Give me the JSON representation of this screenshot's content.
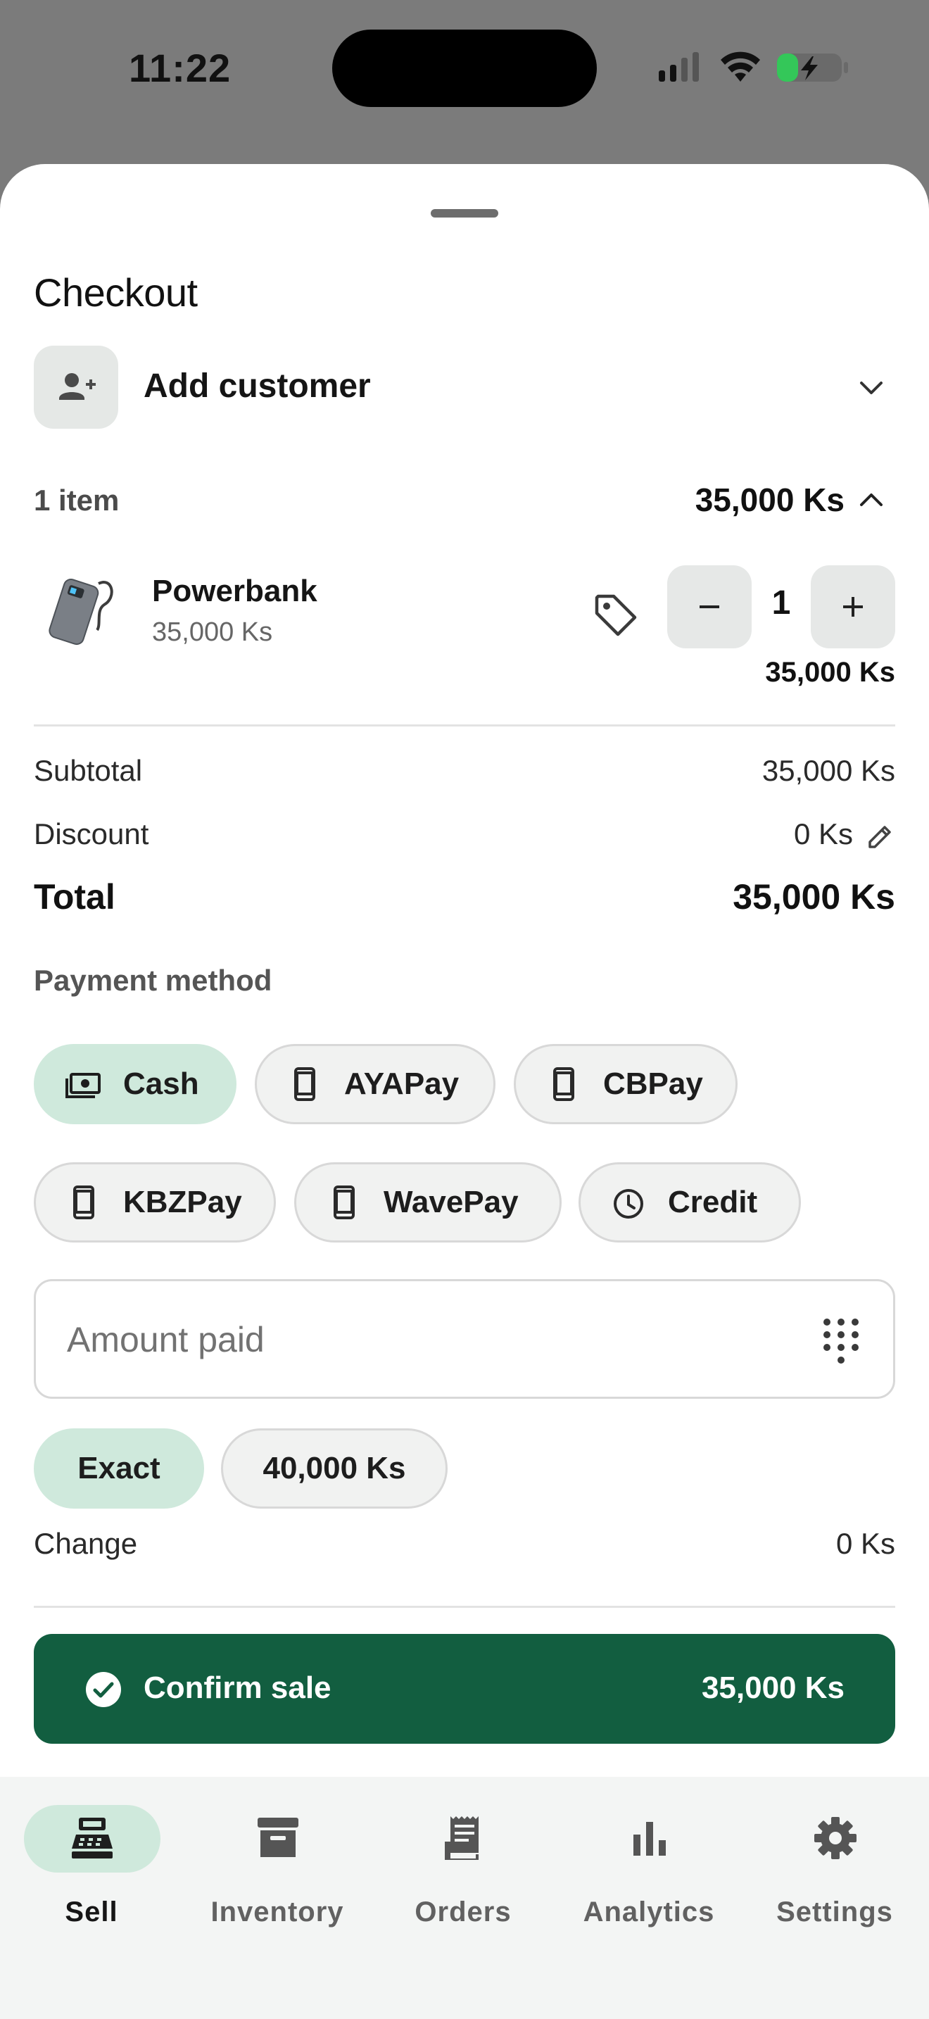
{
  "status_bar": {
    "time": "11:22"
  },
  "checkout": {
    "title": "Checkout",
    "customer": {
      "label": "Add customer"
    },
    "items": {
      "count_label": "1 item",
      "total": "35,000 Ks"
    },
    "products": [
      {
        "name": "Powerbank",
        "unit_price": "35,000 Ks",
        "quantity": "1",
        "line_total": "35,000 Ks"
      }
    ],
    "summary": {
      "subtotal_label": "Subtotal",
      "subtotal_value": "35,000 Ks",
      "discount_label": "Discount",
      "discount_value": "0 Ks",
      "total_label": "Total",
      "total_value": "35,000 Ks"
    },
    "payment": {
      "section_label": "Payment method",
      "methods": [
        {
          "label": "Cash",
          "icon": "cash-icon",
          "selected": true
        },
        {
          "label": "AYAPay",
          "icon": "phone-icon",
          "selected": false
        },
        {
          "label": "CBPay",
          "icon": "phone-icon",
          "selected": false
        },
        {
          "label": "KBZPay",
          "icon": "phone-icon",
          "selected": false
        },
        {
          "label": "WavePay",
          "icon": "phone-icon",
          "selected": false
        },
        {
          "label": "Credit",
          "icon": "clock-icon",
          "selected": false
        }
      ]
    },
    "amount_paid": {
      "placeholder": "Amount paid",
      "value": ""
    },
    "quick_amounts": [
      {
        "label": "Exact",
        "selected": true
      },
      {
        "label": "40,000 Ks",
        "selected": false
      }
    ],
    "change": {
      "label": "Change",
      "value": "0 Ks"
    },
    "confirm": {
      "label": "Confirm sale",
      "amount": "35,000 Ks"
    }
  },
  "nav": {
    "items": [
      {
        "label": "Sell",
        "icon": "register-icon",
        "active": true
      },
      {
        "label": "Inventory",
        "icon": "archive-icon",
        "active": false
      },
      {
        "label": "Orders",
        "icon": "receipt-icon",
        "active": false
      },
      {
        "label": "Analytics",
        "icon": "bar-chart-icon",
        "active": false
      },
      {
        "label": "Settings",
        "icon": "gear-icon",
        "active": false
      }
    ]
  },
  "colors": {
    "accent": "#125e40",
    "accent_light": "#cfe9dc",
    "chip_bg": "#f1f2f1"
  }
}
